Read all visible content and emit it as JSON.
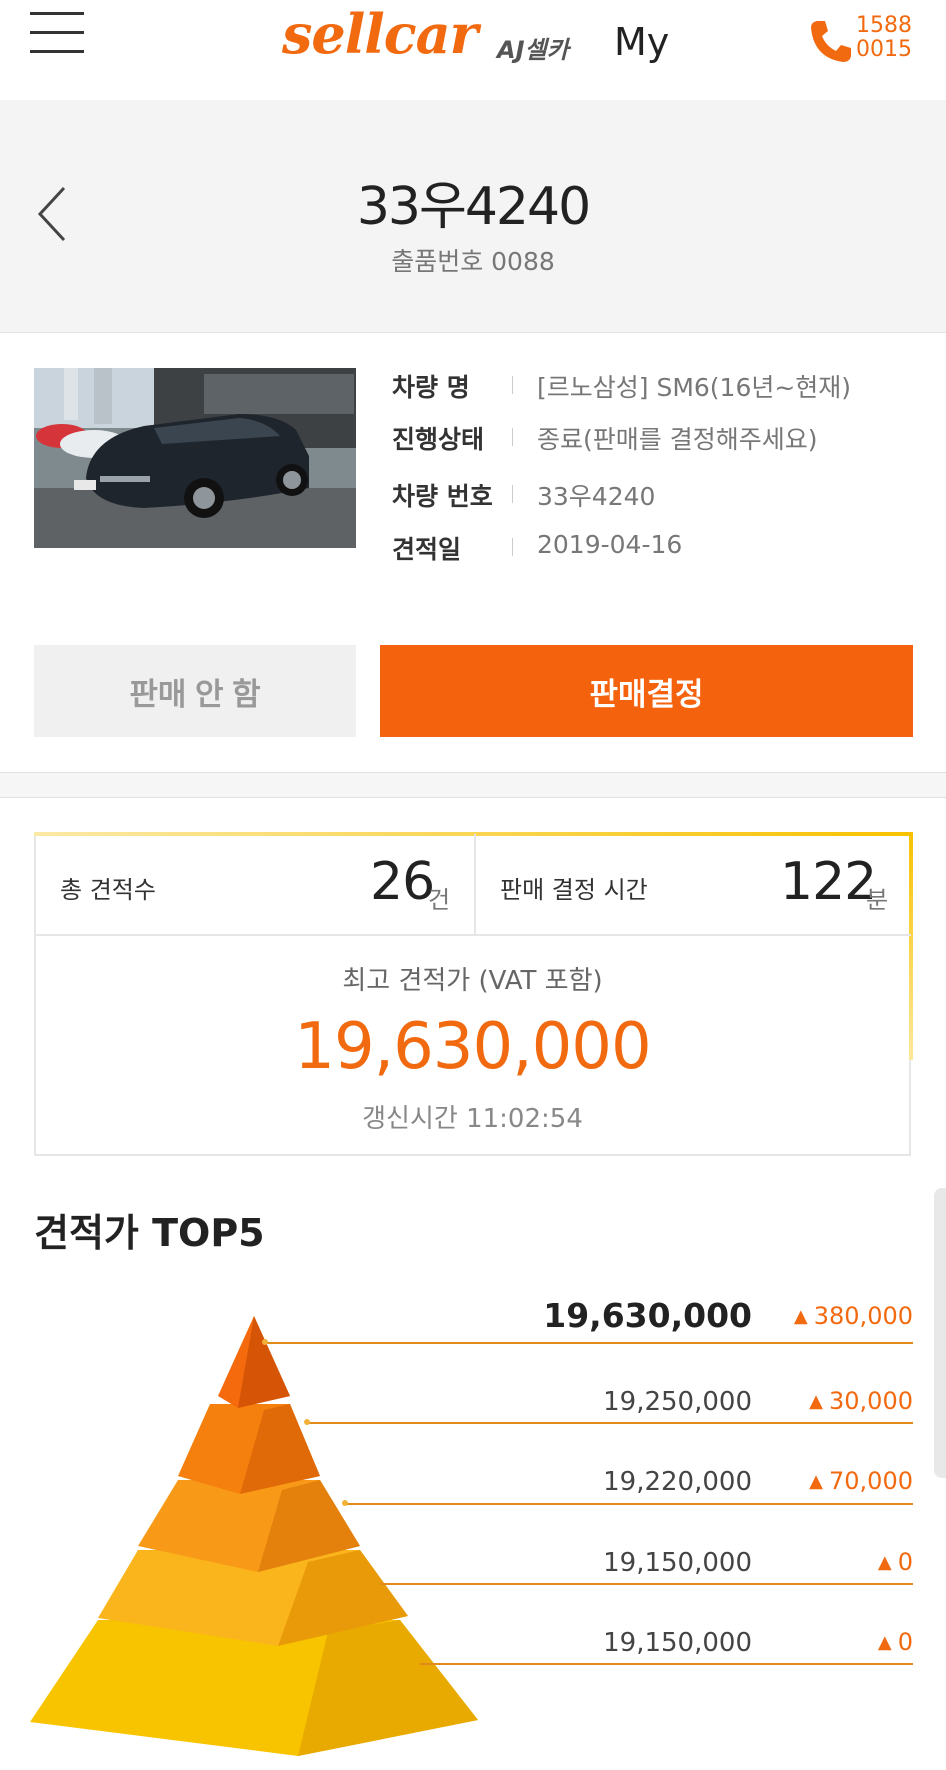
{
  "header": {
    "logo_text": "sellcar",
    "logo_sub": "AJ셀카",
    "my_label": "My",
    "phone_line1": "1588",
    "phone_line2": "0015",
    "brand_color": "#f26a10"
  },
  "title": {
    "car_number": "33우4240",
    "lot_number": "출품번호 0088"
  },
  "vehicle": {
    "rows": [
      {
        "label": "차량 명",
        "value": "[르노삼성] SM6(16년~현재)"
      },
      {
        "label": "진행상태",
        "value": "종료(판매를 결정해주세요)"
      },
      {
        "label": "차량 번호",
        "value": "33우4240"
      },
      {
        "label": "견적일",
        "value": "2019-04-16"
      }
    ]
  },
  "actions": {
    "no_sale_label": "판매 안 함",
    "sell_label": "판매결정",
    "sell_color": "#f5620e"
  },
  "stats": {
    "total_quotes_label": "총 견적수",
    "total_quotes_value": "26",
    "total_quotes_unit": "건",
    "decision_time_label": "판매 결정 시간",
    "decision_time_value": "122",
    "decision_time_unit": "분",
    "best_price_label": "최고 견적가 (VAT 포함)",
    "best_price_value": "19,630,000",
    "update_time": "갱신시간 11:02:54"
  },
  "top5": {
    "title": "견적가 TOP5",
    "items": [
      {
        "price": "19,630,000",
        "diff": "380,000"
      },
      {
        "price": "19,250,000",
        "diff": "30,000"
      },
      {
        "price": "19,220,000",
        "diff": "70,000"
      },
      {
        "price": "19,150,000",
        "diff": "0"
      },
      {
        "price": "19,150,000",
        "diff": "0"
      }
    ]
  }
}
